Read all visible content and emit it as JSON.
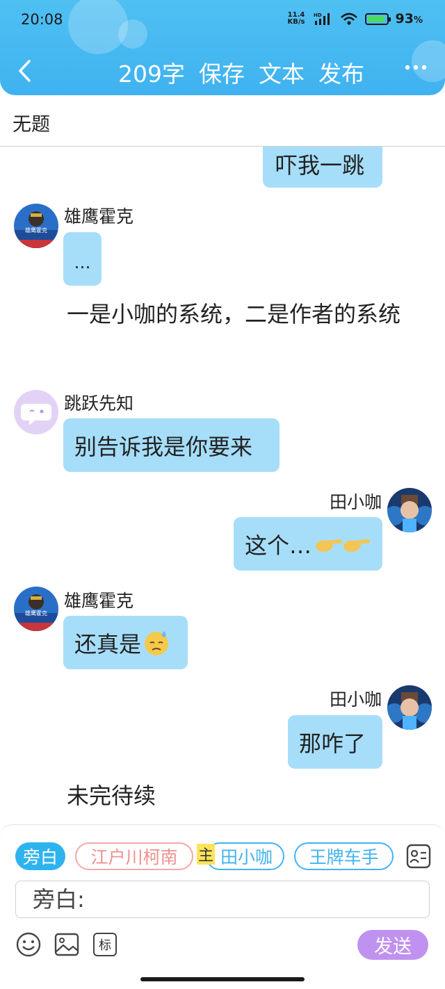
{
  "status_bar": {
    "time": "20:08",
    "net_speed_value": "11.4",
    "net_speed_unit": "KB/s",
    "hd_label": "HD",
    "battery_percent": "93",
    "battery_percent_sign": "%",
    "battery_level": 0.93
  },
  "toolbar": {
    "word_count": "209字",
    "save_label": "保存",
    "text_label": "文本",
    "publish_label": "发布"
  },
  "document": {
    "title": "无题"
  },
  "messages": {
    "m0_text": "吓我一跳",
    "m1_sender": "雄鹰霍克",
    "m1_text": "…",
    "narration1": "一是小咖的系统，二是作者的系统",
    "m2_sender": "跳跃先知",
    "m2_text": "别告诉我是你要来",
    "m3_sender": "田小咖",
    "m3_text": "这个…",
    "m4_sender": "雄鹰霍克",
    "m4_text": "还真是",
    "m5_sender": "田小咖",
    "m5_text": "那咋了",
    "narration2": "未完待续",
    "avatar_badge_text": "雄鹰霍克"
  },
  "roles": {
    "narration": "旁白",
    "conan": "江户川柯南",
    "main_badge": "主",
    "tian": "田小咖",
    "ace": "王牌车手"
  },
  "input": {
    "placeholder": "旁白:"
  },
  "tools": {
    "tag_label": "标",
    "send_label": "发送"
  },
  "colors": {
    "header_blue": "#3fb2f0",
    "bubble_blue": "#a6defa",
    "send_purple": "#c092ef",
    "conan_pink": "#ef8f8f",
    "main_badge_yellow": "#ffe45a"
  },
  "icons": {
    "back": "chevron-left-icon",
    "more": "more-dots-icon",
    "contacts": "contact-card-icon",
    "emoji": "smiley-icon",
    "image": "image-icon",
    "pointing": "pointing-hands-emoji",
    "sweat": "sweat-face-emoji"
  }
}
